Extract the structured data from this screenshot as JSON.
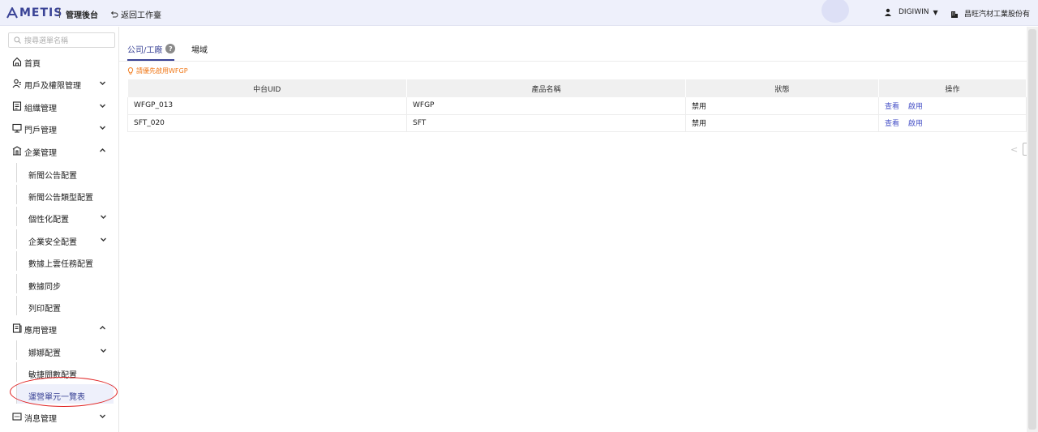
{
  "header": {
    "logo_text": "METIS",
    "admin_title": "管理後台",
    "back_label": "返回工作臺",
    "user_name": "DIGIWIN",
    "company_name": "昌旺汽材工業股份有"
  },
  "sidebar": {
    "search_placeholder": "搜尋選單名稱",
    "items": [
      {
        "label": "首頁",
        "icon": "home-icon"
      },
      {
        "label": "用戶及權限管理",
        "icon": "users-icon",
        "expanded": false
      },
      {
        "label": "組織管理",
        "icon": "org-icon",
        "expanded": false
      },
      {
        "label": "門戶管理",
        "icon": "portal-icon",
        "expanded": false
      },
      {
        "label": "企業管理",
        "icon": "enterprise-icon",
        "expanded": true
      },
      {
        "label": "應用管理",
        "icon": "app-icon",
        "expanded": true
      },
      {
        "label": "消息管理",
        "icon": "message-icon",
        "expanded": false
      }
    ],
    "enterprise_sub": [
      {
        "label": "新聞公告配置"
      },
      {
        "label": "新聞公告類型配置"
      },
      {
        "label": "個性化配置"
      },
      {
        "label": "企業安全配置"
      },
      {
        "label": "數據上雲任務配置"
      },
      {
        "label": "數據同步"
      },
      {
        "label": "列印配置"
      }
    ],
    "app_sub": [
      {
        "label": "娜娜配置"
      },
      {
        "label": "敏捷問數配置"
      },
      {
        "label": "運營單元一覽表"
      }
    ]
  },
  "main": {
    "tabs": [
      {
        "label": "公司/工廠",
        "active": true
      },
      {
        "label": "場域",
        "active": false
      }
    ],
    "help_glyph": "?",
    "notice": "請優先啟用WFGP",
    "table": {
      "headers": [
        "中台UID",
        "產品名稱",
        "狀態",
        "操作"
      ],
      "rows": [
        {
          "uid": "WFGP_013",
          "product": "WFGP",
          "status": "禁用",
          "actions": [
            "查看",
            "啟用"
          ]
        },
        {
          "uid": "SFT_020",
          "product": "SFT",
          "status": "禁用",
          "actions": [
            "查看",
            "啟用"
          ]
        }
      ]
    },
    "pager_prev": "<"
  },
  "colors": {
    "brand": "#3a4396",
    "link": "#4b55c8",
    "notice": "#f07818",
    "annotation": "#e02020"
  }
}
